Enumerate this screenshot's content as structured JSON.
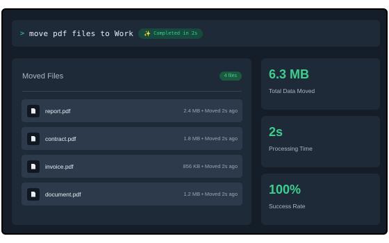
{
  "command": {
    "prompt_symbol": ">",
    "text": "move pdf files to Work",
    "status_icon": "sparkles-icon",
    "status_glyph": "✨",
    "status_text": "Completed in 2s"
  },
  "files_panel": {
    "title": "Moved Files",
    "count_label": "4 files",
    "files": [
      {
        "name": "report.pdf",
        "meta": "2.4 MB • Moved 2s ago",
        "icon": "document-icon"
      },
      {
        "name": "contract.pdf",
        "meta": "1.8 MB • Moved 2s ago",
        "icon": "document-icon"
      },
      {
        "name": "invoice.pdf",
        "meta": "856 KB • Moved 2s ago",
        "icon": "document-icon"
      },
      {
        "name": "document.pdf",
        "meta": "1.2 MB • Moved 2s ago",
        "icon": "document-icon"
      }
    ]
  },
  "stats": [
    {
      "value": "6.3 MB",
      "label": "Total Data Moved"
    },
    {
      "value": "2s",
      "label": "Processing Time"
    },
    {
      "value": "100%",
      "label": "Success Rate"
    }
  ],
  "colors": {
    "accent": "#3ecf8e",
    "background": "#141d28",
    "panel": "#1e2a38",
    "row": "#2c3a4c"
  }
}
